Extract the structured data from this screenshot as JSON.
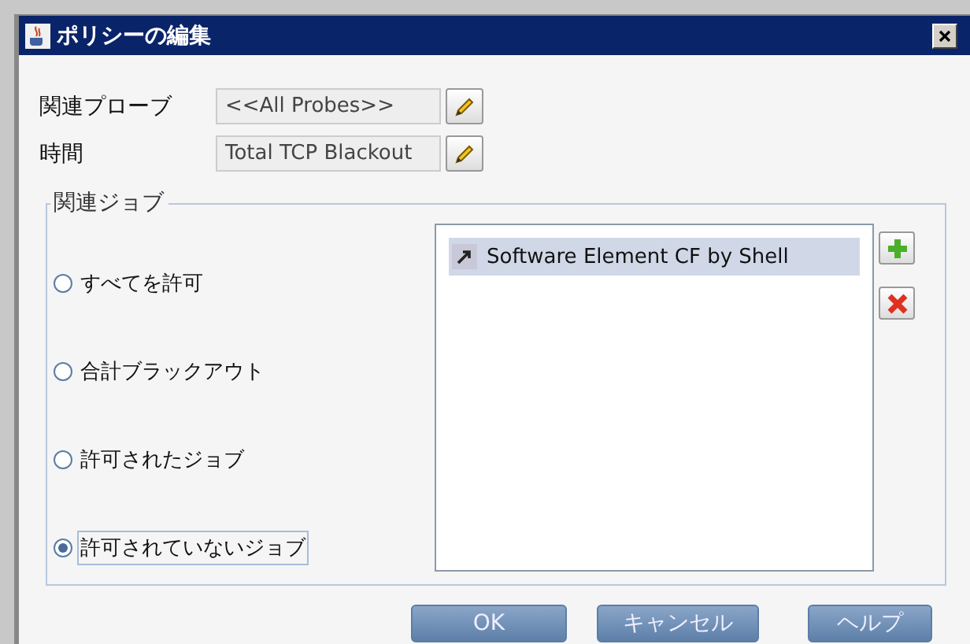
{
  "window": {
    "title": "ポリシーの編集"
  },
  "fields": [
    {
      "label": "関連プローブ",
      "value": "<<All Probes>>"
    },
    {
      "label": "時間",
      "value": "Total TCP Blackout"
    }
  ],
  "jobs_group": {
    "legend": "関連ジョブ",
    "options": [
      {
        "label": "すべてを許可",
        "selected": false
      },
      {
        "label": "合計ブラックアウト",
        "selected": false
      },
      {
        "label": "許可されたジョブ",
        "selected": false
      },
      {
        "label": "許可されていないジョブ",
        "selected": true
      }
    ],
    "jobs": [
      {
        "name": "Software Element CF by Shell",
        "selected": true
      }
    ]
  },
  "buttons": [
    {
      "label": "OK"
    },
    {
      "label": "キャンセル"
    },
    {
      "label": "ヘルプ"
    }
  ]
}
